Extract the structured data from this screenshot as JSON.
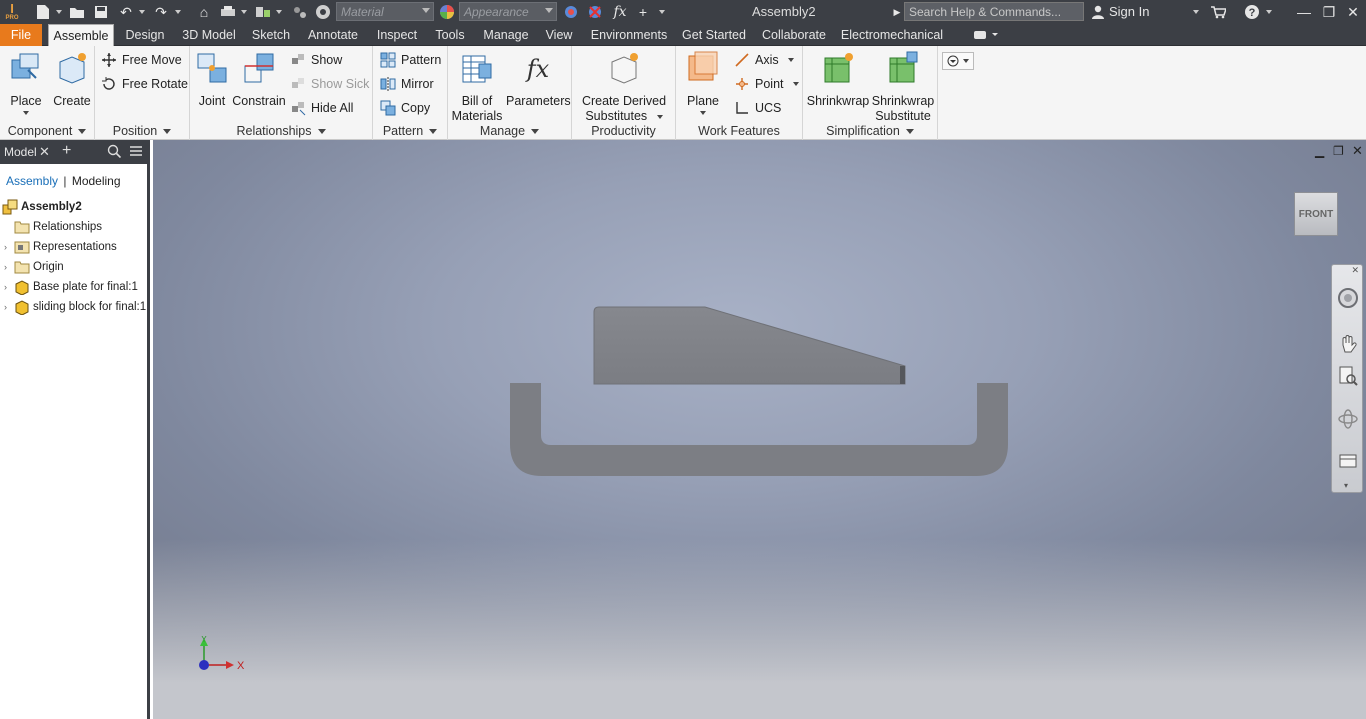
{
  "titlebar": {
    "app_badge": "PRO",
    "material_placeholder": "Material",
    "appearance_placeholder": "Appearance",
    "fx_label": "fx",
    "doc_title": "Assembly2",
    "search_placeholder": "Search Help & Commands...",
    "sign_in": "Sign In"
  },
  "menu": {
    "file": "File",
    "tabs": [
      "Assemble",
      "Design",
      "3D Model",
      "Sketch",
      "Annotate",
      "Inspect",
      "Tools",
      "Manage",
      "View",
      "Environments",
      "Get Started",
      "Collaborate",
      "Electromechanical"
    ]
  },
  "ribbon": {
    "component": {
      "title": "Component",
      "place": "Place",
      "create": "Create"
    },
    "position": {
      "title": "Position",
      "free_move": "Free Move",
      "free_rotate": "Free Rotate"
    },
    "relationships": {
      "title": "Relationships",
      "joint": "Joint",
      "constrain": "Constrain",
      "show": "Show",
      "show_sick": "Show Sick",
      "hide_all": "Hide All"
    },
    "pattern": {
      "title": "Pattern",
      "pattern": "Pattern",
      "mirror": "Mirror",
      "copy": "Copy"
    },
    "manage": {
      "title": "Manage",
      "bom_line1": "Bill of",
      "bom_line2": "Materials",
      "parameters": "Parameters"
    },
    "productivity": {
      "title": "Productivity",
      "cds_line1": "Create Derived",
      "cds_line2": "Substitutes"
    },
    "work_features": {
      "title": "Work Features",
      "plane": "Plane",
      "axis": "Axis",
      "point": "Point",
      "ucs": "UCS"
    },
    "simplification": {
      "title": "Simplification",
      "shrinkwrap": "Shrinkwrap",
      "sws_line1": "Shrinkwrap",
      "sws_line2": "Substitute"
    }
  },
  "browser": {
    "tab_label": "Model",
    "mode_assembly": "Assembly",
    "mode_modeling": "Modeling",
    "root": "Assembly2",
    "items": [
      "Relationships",
      "Representations",
      "Origin",
      "Base plate for final:1",
      "sliding block for final:1"
    ]
  },
  "viewport": {
    "viewcube_label": "FRONT",
    "axis_x": "X",
    "axis_y": "Y"
  }
}
